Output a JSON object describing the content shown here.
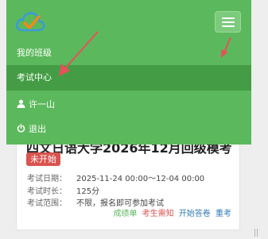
{
  "colors": {
    "nav_green": "#5cb85c",
    "nav_active": "#449d44",
    "badge_red": "#d9534f",
    "link_blue": "#337ab7",
    "arrow_red": "#e8505b"
  },
  "header": {
    "logo_icon": "cloud-check-logo",
    "menu_icon": "hamburger-icon"
  },
  "nav": {
    "items": [
      {
        "label": "我的班级"
      },
      {
        "label": "考试中心",
        "active": true
      },
      {
        "label": "许一山",
        "icon": "user-icon"
      },
      {
        "label": "退出",
        "icon": "power-icon"
      }
    ]
  },
  "exam": {
    "title": "四文日语大学2026年12月回级模考",
    "status": "未开始",
    "date_label": "考试日期：",
    "date_value": "2025-11-24 00:00～12-04 00:00",
    "duration_label": "考试时长：",
    "duration_value": "125分",
    "scope_label": "考试范围：",
    "scope_value": "不限，报名即可参加考试",
    "actions": {
      "grades": "成绩单",
      "notice": "考生需知",
      "start": "开始答卷",
      "retake": "重考"
    }
  }
}
